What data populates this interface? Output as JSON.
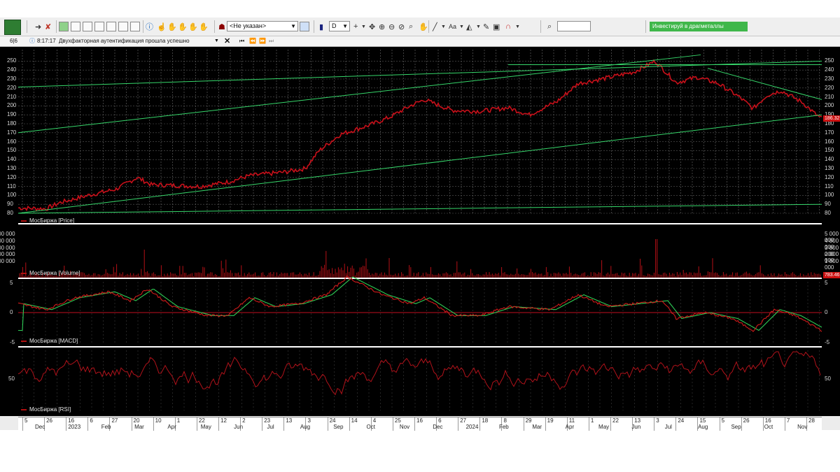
{
  "toolbar": {
    "account_combo": "<Не указан>",
    "interval_combo": "D",
    "invest_banner": "Инвестируй в драгметаллы"
  },
  "statusbar": {
    "counter": "6|6",
    "time": "8:17:17",
    "message": "Двухфакторная аутентификация прошла успешно"
  },
  "panels": {
    "price_label": "МосБиржа [Price]",
    "volume_label": "МосБиржа [Volume]",
    "macd_label": "МосБиржа [MACD]",
    "rsi_label": "МосБиржа [RSI]",
    "price_last": "186.32",
    "volume_last": "783.46"
  },
  "price_axis": [
    "250",
    "240",
    "230",
    "220",
    "210",
    "200",
    "190",
    "180",
    "170",
    "160",
    "150",
    "140",
    "130",
    "120",
    "110",
    "100",
    "90",
    "80"
  ],
  "volume_axis": [
    "5 000 000",
    "4 000 000",
    "3 000 000",
    "2 000 000",
    "1 000 000"
  ],
  "macd_axis": [
    "5",
    "0",
    "-5"
  ],
  "rsi_axis": [
    "50"
  ],
  "date_axis": {
    "days": [
      "5",
      "26",
      "16",
      "6",
      "27",
      "20",
      "10",
      "1",
      "22",
      "12",
      "2",
      "23",
      "13",
      "3",
      "24",
      "14",
      "4",
      "25",
      "16",
      "6",
      "27",
      "18",
      "8",
      "29",
      "19",
      "11",
      "1",
      "22",
      "13",
      "3",
      "24",
      "15",
      "5",
      "26",
      "16",
      "7",
      "28"
    ],
    "months": [
      "Dec",
      "2023",
      "Feb",
      "Mar",
      "Apr",
      "May",
      "Jun",
      "Jul",
      "Aug",
      "Sep",
      "Oct",
      "Nov",
      "Dec",
      "2024",
      "Feb",
      "Mar",
      "Apr",
      "May",
      "Jun",
      "Jul",
      "Aug",
      "Sep",
      "Oct",
      "Nov"
    ]
  },
  "colors": {
    "price_line": "#c8101a",
    "trend_lines": "#36d66a",
    "macd_signal": "#2ecc55",
    "background": "#000000"
  }
}
